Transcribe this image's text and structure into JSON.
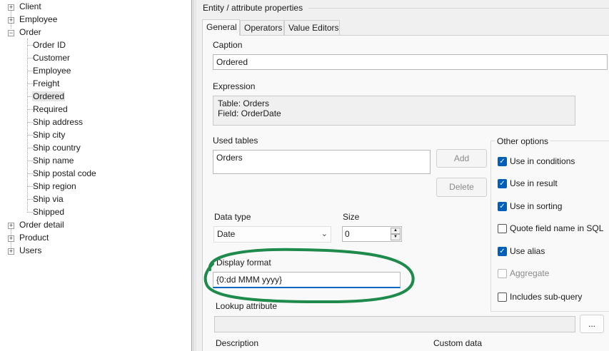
{
  "tree": {
    "items": [
      {
        "label": "Client",
        "expander": "+"
      },
      {
        "label": "Employee",
        "expander": "+"
      },
      {
        "label": "Order",
        "expander": "−"
      },
      {
        "label": "Order ID"
      },
      {
        "label": "Customer"
      },
      {
        "label": "Employee"
      },
      {
        "label": "Freight"
      },
      {
        "label": "Ordered"
      },
      {
        "label": "Required"
      },
      {
        "label": "Ship address"
      },
      {
        "label": "Ship city"
      },
      {
        "label": "Ship country"
      },
      {
        "label": "Ship name"
      },
      {
        "label": "Ship postal code"
      },
      {
        "label": "Ship region"
      },
      {
        "label": "Ship via"
      },
      {
        "label": "Shipped"
      },
      {
        "label": "Order detail",
        "expander": "+"
      },
      {
        "label": "Product",
        "expander": "+"
      },
      {
        "label": "Users",
        "expander": "+"
      }
    ],
    "selected": "Ordered"
  },
  "panel": {
    "title": "Entity / attribute properties",
    "tabs": [
      {
        "label": "General"
      },
      {
        "label": "Operators"
      },
      {
        "label": "Value Editors"
      }
    ],
    "active_tab": "General"
  },
  "general": {
    "caption_label": "Caption",
    "caption_value": "Ordered",
    "expression_label": "Expression",
    "expression_table": "Table: Orders",
    "expression_field": "Field: OrderDate",
    "used_tables_label": "Used tables",
    "used_tables": [
      "Orders"
    ],
    "add_button": "Add",
    "delete_button": "Delete",
    "data_type_label": "Data type",
    "data_type_value": "Date",
    "size_label": "Size",
    "size_value": "0",
    "display_format_label": "Display format",
    "display_format_value": "{0:dd MMM yyyy}",
    "lookup_label": "Lookup attribute",
    "lookup_value": "",
    "lookup_button": "...",
    "description_label": "Description",
    "custom_data_label": "Custom data"
  },
  "options": {
    "title": "Other options",
    "items": [
      {
        "label": "Use in conditions",
        "checked": true,
        "enabled": true
      },
      {
        "label": "Use in result",
        "checked": true,
        "enabled": true
      },
      {
        "label": "Use in sorting",
        "checked": true,
        "enabled": true
      },
      {
        "label": "Quote field name in SQL",
        "checked": false,
        "enabled": true
      },
      {
        "label": "Use alias",
        "checked": true,
        "enabled": true
      },
      {
        "label": "Aggregate",
        "checked": false,
        "enabled": false
      },
      {
        "label": "Includes sub-query",
        "checked": false,
        "enabled": true
      }
    ]
  },
  "colors": {
    "highlight_circle": "#1e8a4c",
    "checkbox_accent": "#005fb8",
    "focus_underline": "#0067c0"
  }
}
